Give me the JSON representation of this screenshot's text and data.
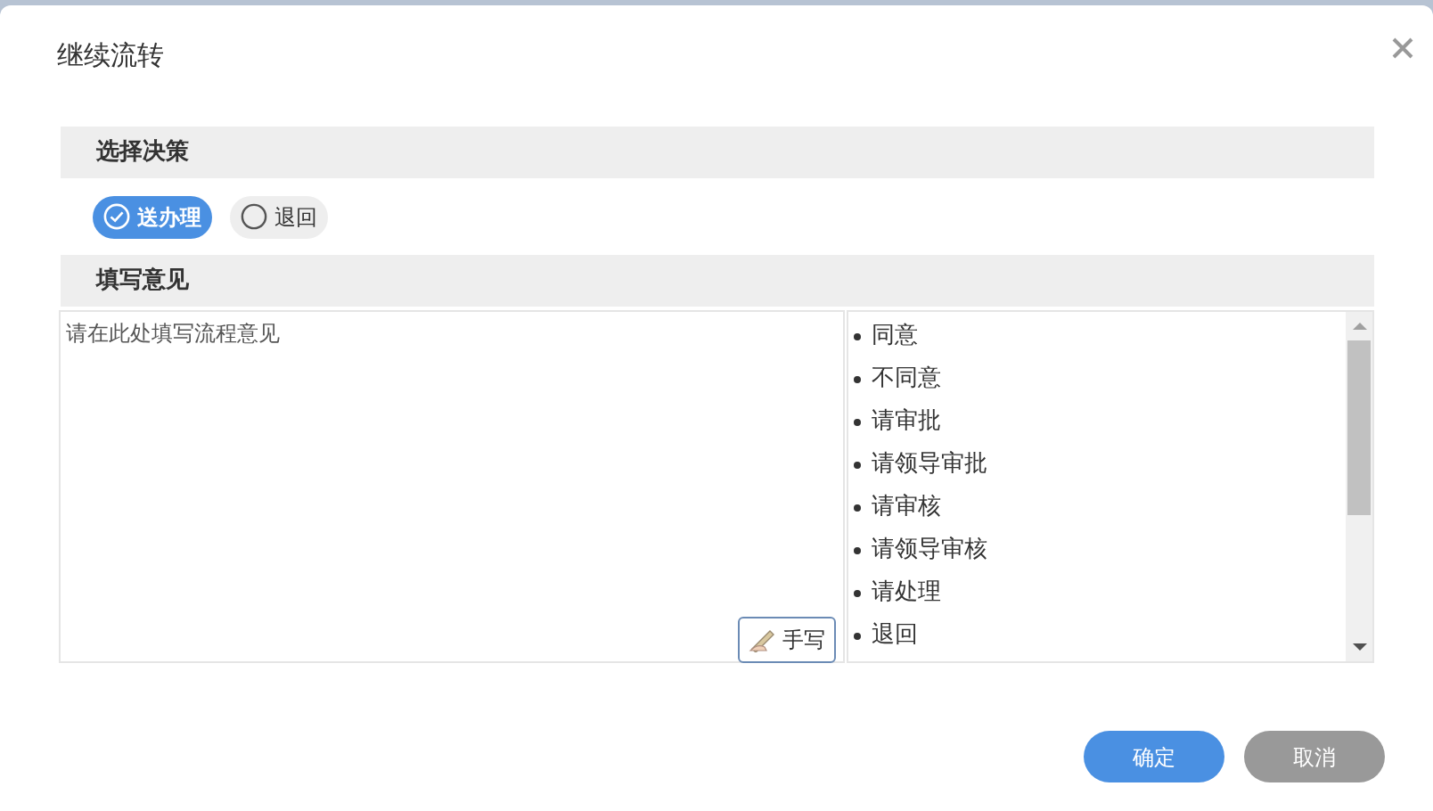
{
  "window": {
    "title": "继续流转"
  },
  "decision": {
    "heading": "选择决策",
    "options": [
      {
        "label": "送办理",
        "selected": true
      },
      {
        "label": "退回",
        "selected": false
      }
    ]
  },
  "opinion": {
    "heading": "填写意见",
    "placeholder": "请在此处填写流程意见",
    "handwrite_button": "手写",
    "phrases": [
      "同意",
      "不同意",
      "请审批",
      "请领导审批",
      "请审核",
      "请领导审核",
      "请处理",
      "退回"
    ]
  },
  "buttons": [
    {
      "label": "确定",
      "kind": "primary"
    },
    {
      "label": "取消",
      "kind": "secondary"
    }
  ]
}
